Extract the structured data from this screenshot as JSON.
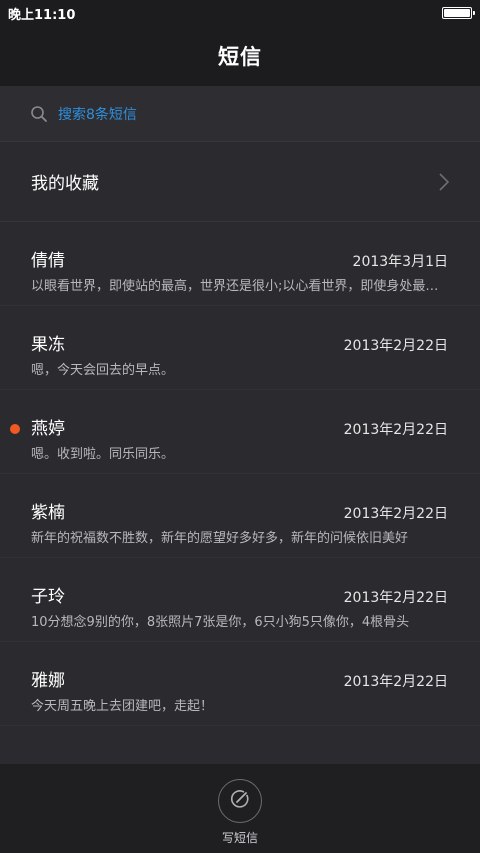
{
  "status_bar": {
    "time": "晚上11:10",
    "battery_level": 1.0
  },
  "header": {
    "title": "短信"
  },
  "search": {
    "label": "搜索8条短信",
    "icon": "search-icon"
  },
  "favorites": {
    "label": "我的收藏",
    "icon": "chevron-right-icon"
  },
  "messages": [
    {
      "name": "倩倩",
      "date": "2013年3月1日",
      "preview": "以眼看世界，即使站的最高，世界还是很小;以心看世界，即使身处最低，世界也会很大",
      "unread": false
    },
    {
      "name": "果冻",
      "date": "2013年2月22日",
      "preview": "嗯，今天会回去的早点。",
      "unread": false
    },
    {
      "name": "燕婷",
      "date": "2013年2月22日",
      "preview": "嗯。收到啦。同乐同乐。",
      "unread": true
    },
    {
      "name": "紫楠",
      "date": "2013年2月22日",
      "preview": "新年的祝福数不胜数，新年的愿望好多好多，新年的问候依旧美好",
      "unread": false
    },
    {
      "name": "子玲",
      "date": "2013年2月22日",
      "preview": "10分想念9别的你，8张照片7张是你，6只小狗5只像你，4根骨头",
      "unread": false
    },
    {
      "name": "雅娜",
      "date": "2013年2月22日",
      "preview": "今天周五晚上去团建吧，走起！",
      "unread": false
    }
  ],
  "bottom_bar": {
    "compose_label": "写短信",
    "icon": "compose-icon"
  },
  "colors": {
    "accent": "#2f8fdc",
    "unread": "#f05a22",
    "background": "#2b2b2f"
  }
}
